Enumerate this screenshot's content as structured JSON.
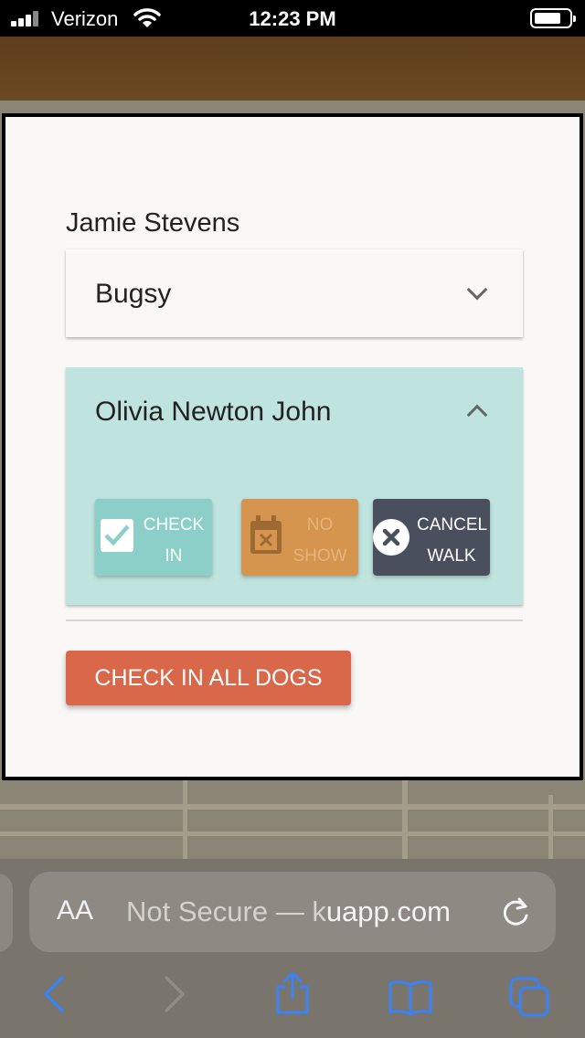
{
  "status_bar": {
    "carrier": "Verizon",
    "time": "12:23 PM"
  },
  "modal": {
    "owner_name": "Jamie Stevens",
    "dogs": [
      {
        "name": "Bugsy",
        "expanded": false
      },
      {
        "name": "Olivia Newton John",
        "expanded": true
      }
    ],
    "actions": {
      "check_in": {
        "line1": "CHECK",
        "line2": "IN"
      },
      "no_show": {
        "line1": "NO",
        "line2": "SHOW"
      },
      "cancel_walk": {
        "line1": "CANCEL",
        "line2": "WALK"
      }
    },
    "check_in_all_label": "CHECK IN ALL DOGS"
  },
  "browser": {
    "text_size_label": "AA",
    "url_prefix": "Not Secure — ",
    "url_partial": "k",
    "url_domain": "uapp.com"
  },
  "colors": {
    "check_in": "#8ccfc8",
    "no_show": "#d6954f",
    "cancel_walk": "#4a4f5e",
    "check_in_all": "#d9674a",
    "expanded_panel": "#bfe3de"
  }
}
